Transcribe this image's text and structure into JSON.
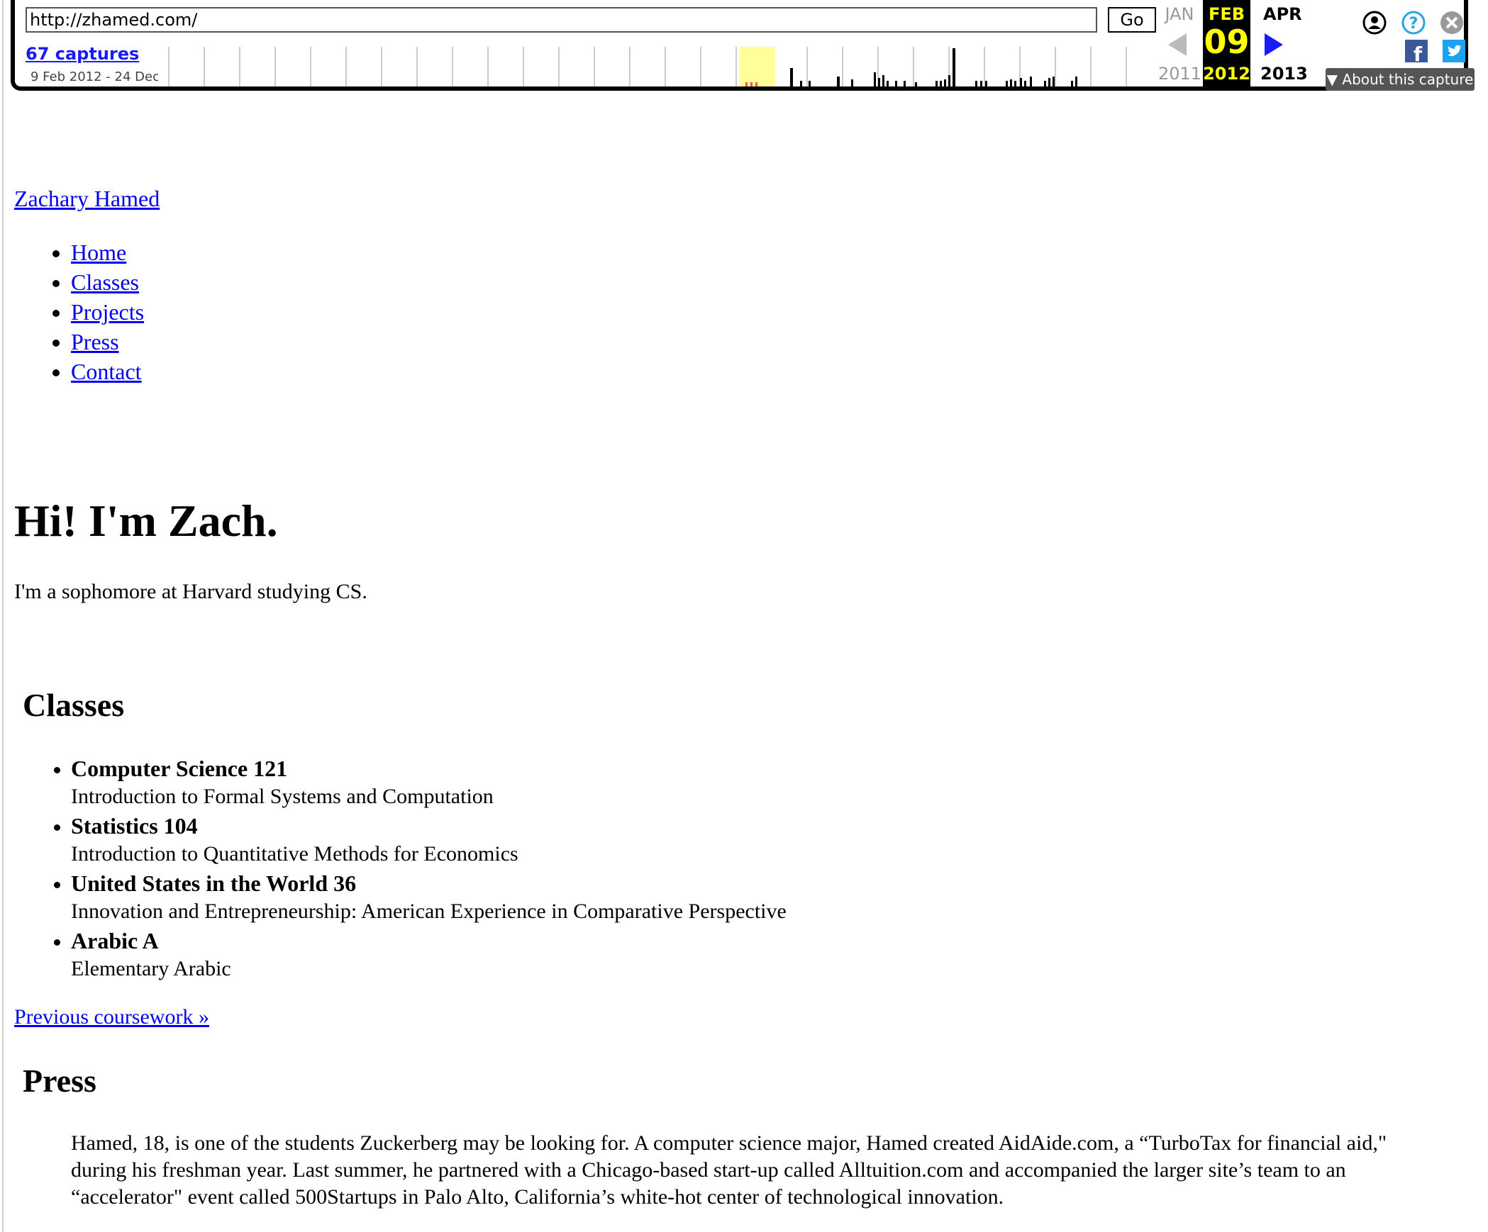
{
  "wayback": {
    "url_value": "http://zhamed.com/",
    "go_label": "Go",
    "captures_label": "67 captures",
    "date_range": "9 Feb 2012 - 24 Dec",
    "prev_month": "JAN",
    "cur_month": "FEB",
    "next_month": "APR",
    "cur_day": "09",
    "prev_year": "2011",
    "cur_year": "2012",
    "next_year": "2013",
    "about_label": "About this capture",
    "icons": [
      "user-icon",
      "help-icon",
      "close-icon",
      "facebook-icon",
      "twitter-icon"
    ],
    "colors": {
      "current_bg": "#000000",
      "current_fg": "#ffff00",
      "link": "#1a1aff"
    }
  },
  "site": {
    "title": "Zachary Hamed",
    "nav": [
      "Home",
      "Classes",
      "Projects",
      "Press",
      "Contact"
    ]
  },
  "hero": {
    "heading": "Hi! I'm Zach.",
    "intro": "I'm a sophomore at Harvard studying CS."
  },
  "classes": {
    "heading": "Classes",
    "items": [
      {
        "name": "Computer Science 121",
        "desc": "Introduction to Formal Systems and Computation"
      },
      {
        "name": "Statistics 104",
        "desc": "Introduction to Quantitative Methods for Economics"
      },
      {
        "name": "United States in the World 36",
        "desc": "Innovation and Entrepreneurship: American Experience in Comparative Perspective"
      },
      {
        "name": "Arabic A",
        "desc": "Elementary Arabic"
      }
    ],
    "previous_link": "Previous coursework »"
  },
  "press": {
    "heading": "Press",
    "quote": "Hamed, 18, is one of the students Zuckerberg may be looking for. A computer science major, Hamed created AidAide.com, a “TurboTax for financial aid,\" during his freshman year. Last summer, he partnered with a Chicago-based start-up called Alltuition.com and accompanied the larger site’s team to an “accelerator\" event called 500Startups in Palo Alto, California’s white-hot center of technological innovation."
  }
}
